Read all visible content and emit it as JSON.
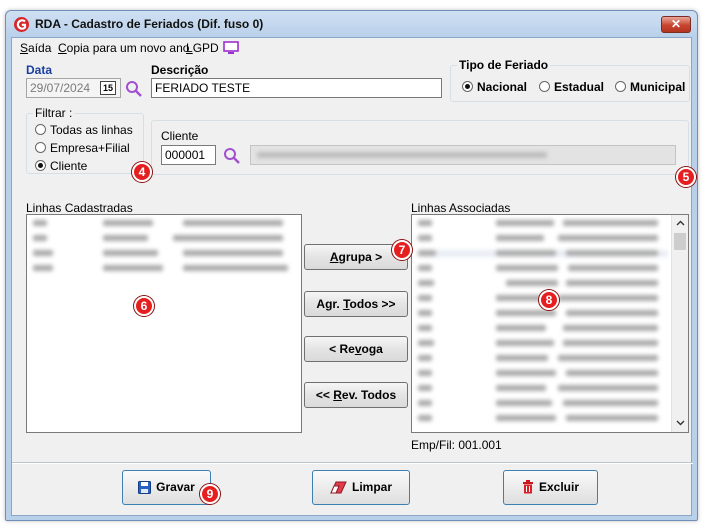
{
  "window": {
    "title": "RDA - Cadastro de Feriados (Dif. fuso 0)",
    "close_glyph": "✕"
  },
  "menu": [
    {
      "first": "S",
      "rest": "aída"
    },
    {
      "first": "C",
      "rest": "opia para um novo ano"
    },
    {
      "first": "L",
      "rest": "GPD"
    }
  ],
  "form": {
    "data_label": "Data",
    "data_value": "29/07/2024",
    "calendar_glyph": "15",
    "descricao_label": "Descrição",
    "descricao_value": "FERIADO TESTE"
  },
  "tipo_feriado": {
    "legend": "Tipo de Feriado",
    "options": [
      "Nacional",
      "Estadual",
      "Municipal"
    ],
    "selected": "Nacional"
  },
  "filtrar": {
    "legend": "Filtrar :",
    "options": [
      "Todas as linhas",
      "Empresa+Filial",
      "Cliente"
    ],
    "selected": "Cliente"
  },
  "cliente": {
    "label": "Cliente",
    "code": "000001"
  },
  "lists": {
    "cadastradas_label": "Linhas Cadastradas",
    "associadas_label": "Linhas Associadas",
    "empfil": "Emp/Fil: 001.001"
  },
  "buttons": {
    "agrupa": {
      "u": "A",
      "rest": "grupa >"
    },
    "agr_todos": {
      "pre": "Agr. ",
      "u": "T",
      "rest": "odos >>"
    },
    "revoga": {
      "pre": "< Re",
      "u": "v",
      "rest": "oga"
    },
    "rev_todos": {
      "pre": "<< ",
      "u": "R",
      "rest": "ev. Todos"
    },
    "gravar": "Gravar",
    "limpar": "Limpar",
    "excluir": "Excluir"
  },
  "badges": [
    "4",
    "5",
    "6",
    "7",
    "8",
    "9"
  ],
  "colors": {
    "badge": "#e51f1f",
    "accent_blue": "#1a3ea1",
    "search_icon": "#a24fd0"
  }
}
